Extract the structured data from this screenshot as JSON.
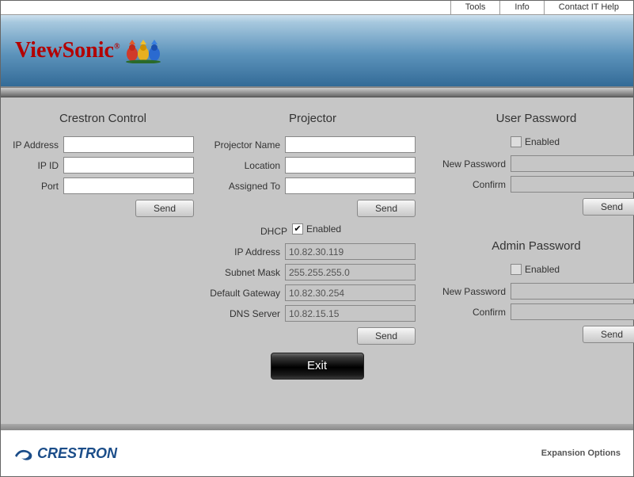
{
  "topbar": {
    "tools": "Tools",
    "info": "Info",
    "contact": "Contact IT Help"
  },
  "brand": "ViewSonic",
  "sections": {
    "crestron": {
      "title": "Crestron Control",
      "ip_label": "IP Address",
      "ip_value": "",
      "ipid_label": "IP ID",
      "ipid_value": "",
      "port_label": "Port",
      "port_value": "",
      "send": "Send"
    },
    "projector": {
      "title": "Projector",
      "name_label": "Projector Name",
      "name_value": "",
      "location_label": "Location",
      "location_value": "",
      "assigned_label": "Assigned To",
      "assigned_value": "",
      "send1": "Send",
      "dhcp_label": "DHCP",
      "dhcp_enabled_text": "Enabled",
      "ip_label": "IP Address",
      "ip_value": "10.82.30.119",
      "subnet_label": "Subnet Mask",
      "subnet_value": "255.255.255.0",
      "gateway_label": "Default Gateway",
      "gateway_value": "10.82.30.254",
      "dns_label": "DNS Server",
      "dns_value": "10.82.15.15",
      "send2": "Send"
    },
    "userpw": {
      "title": "User Password",
      "enabled_text": "Enabled",
      "new_label": "New Password",
      "confirm_label": "Confirm",
      "send": "Send"
    },
    "adminpw": {
      "title": "Admin Password",
      "enabled_text": "Enabled",
      "new_label": "New Password",
      "confirm_label": "Confirm",
      "send": "Send"
    }
  },
  "exit": "Exit",
  "footer": {
    "crestron": "CRESTRON",
    "expansion": "Expansion Options"
  }
}
